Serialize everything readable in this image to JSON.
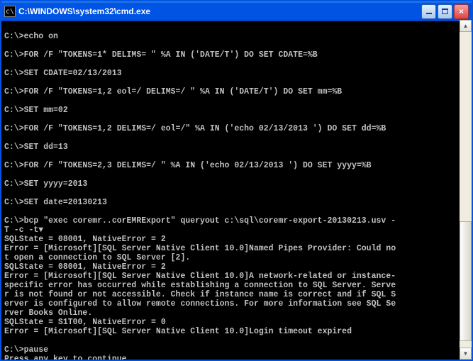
{
  "window": {
    "title": "C:\\WINDOWS\\system32\\cmd.exe"
  },
  "console": {
    "lines": [
      "",
      "C:\\>echo on",
      "",
      "C:\\>FOR /F \"TOKENS=1* DELIMS= \" %A IN ('DATE/T') DO SET CDATE=%B",
      "",
      "C:\\>SET CDATE=02/13/2013",
      "",
      "C:\\>FOR /F \"TOKENS=1,2 eol=/ DELIMS=/ \" %A IN ('DATE/T') DO SET mm=%B",
      "",
      "C:\\>SET mm=02",
      "",
      "C:\\>FOR /F \"TOKENS=1,2 DELIMS=/ eol=/\" %A IN ('echo 02/13/2013 ') DO SET dd=%B",
      "",
      "C:\\>SET dd=13",
      "",
      "C:\\>FOR /F \"TOKENS=2,3 DELIMS=/ \" %A IN ('echo 02/13/2013 ') DO SET yyyy=%B",
      "",
      "C:\\>SET yyyy=2013",
      "",
      "C:\\>SET date=20130213",
      "",
      "C:\\>bcp \"exec coremr..corEMRExport\" queryout c:\\sql\\coremr-export-20130213.usv -",
      "T -c -t▼",
      "SQLState = 08001, NativeError = 2",
      "Error = [Microsoft][SQL Server Native Client 10.0]Named Pipes Provider: Could no",
      "t open a connection to SQL Server [2].",
      "SQLState = 08001, NativeError = 2",
      "Error = [Microsoft][SQL Server Native Client 10.0]A network-related or instance-",
      "specific error has occurred while establishing a connection to SQL Server. Serve",
      "r is not found or not accessible. Check if instance name is correct and if SQL S",
      "erver is configured to allow remote connections. For more information see SQL Se",
      "rver Books Online.",
      "SQLState = S1T00, NativeError = 0",
      "Error = [Microsoft][SQL Server Native Client 10.0]Login timeout expired",
      "",
      "C:\\>pause",
      "Press any key to continue . . . "
    ]
  }
}
